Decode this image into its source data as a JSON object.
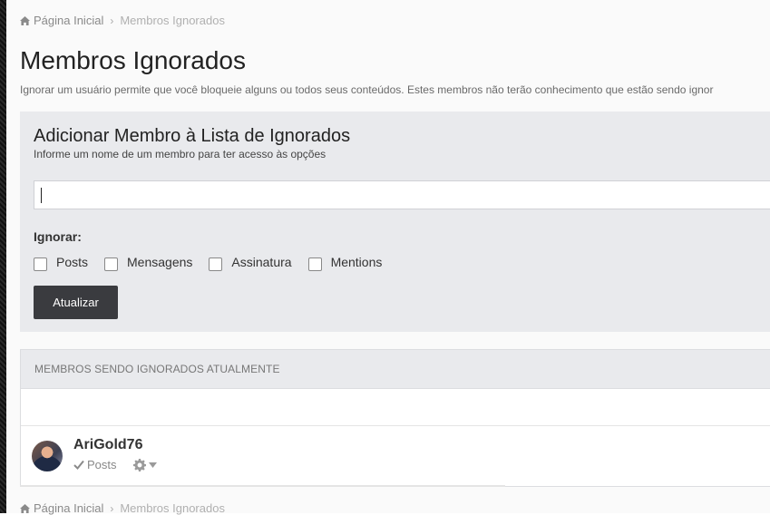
{
  "breadcrumb": {
    "home_label": "Página Inicial",
    "current_label": "Membros Ignorados"
  },
  "page": {
    "title": "Membros Ignorados",
    "description": "Ignorar um usuário permite que você bloqueie alguns ou todos seus conteúdos. Estes membros não terão conhecimento que estão sendo ignor"
  },
  "add_form": {
    "title": "Adicionar Membro à Lista de Ignorados",
    "subtitle": "Informe um nome de um membro para ter acesso às opções",
    "input_value": "",
    "ignore_label": "Ignorar:",
    "options": [
      {
        "label": "Posts",
        "checked": false
      },
      {
        "label": "Mensagens",
        "checked": false
      },
      {
        "label": "Assinatura",
        "checked": false
      },
      {
        "label": "Mentions",
        "checked": false
      }
    ],
    "submit_label": "Atualizar"
  },
  "ignored_list": {
    "header": "MEMBROS SENDO IGNORADOS ATUALMENTE",
    "members": [
      {
        "name": "AriGold76",
        "ignoring": "Posts"
      }
    ]
  },
  "footer_breadcrumb": {
    "home_label": "Página Inicial",
    "current_label": "Membros Ignorados"
  },
  "icons": {
    "home": "home-icon",
    "check": "check-icon",
    "gear": "gear-icon",
    "caret": "caret-down-icon"
  },
  "colors": {
    "panel_bg": "#e9eaed",
    "button_bg": "#3a3b3f",
    "muted_text": "#8a8a8a"
  }
}
